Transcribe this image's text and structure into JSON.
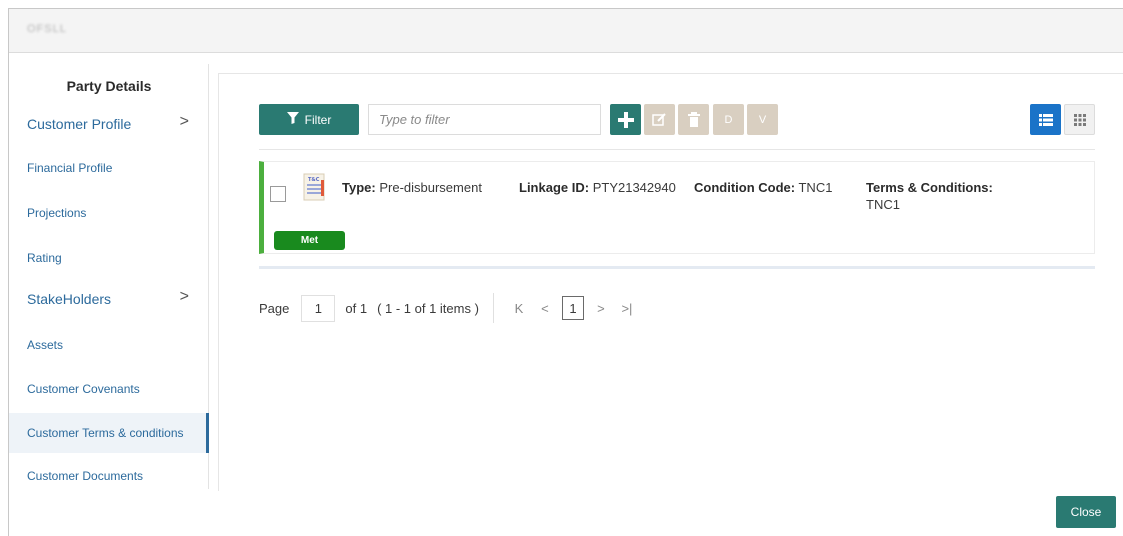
{
  "window": {
    "title": "OFSLL"
  },
  "sidebar": {
    "heading": "Party Details",
    "items": [
      {
        "label": "Customer Profile",
        "has_submenu": true
      },
      {
        "label": "Financial Profile",
        "has_submenu": false
      },
      {
        "label": "Projections",
        "has_submenu": false
      },
      {
        "label": "Rating",
        "has_submenu": false
      },
      {
        "label": "StakeHolders",
        "has_submenu": true
      },
      {
        "label": "Assets",
        "has_submenu": false
      },
      {
        "label": "Customer Covenants",
        "has_submenu": false
      },
      {
        "label": "Customer Terms & conditions",
        "has_submenu": false,
        "active": true
      },
      {
        "label": "Customer Documents",
        "has_submenu": false
      }
    ],
    "chevron": ">"
  },
  "toolbar": {
    "filter_label": "Filter",
    "filter_placeholder": "Type to filter",
    "add_icon": "plus-icon",
    "edit_icon": "edit-icon",
    "delete_icon": "trash-icon",
    "d_label": "D",
    "v_label": "V",
    "list_view_icon": "list-view-icon",
    "grid_view_icon": "grid-view-icon"
  },
  "records": [
    {
      "type_label": "Type:",
      "type_value": "Pre-disbursement",
      "linkage_label": "Linkage ID:",
      "linkage_value": "PTY21342940",
      "code_label": "Condition Code:",
      "code_value": "TNC1",
      "terms_label": "Terms & Conditions:",
      "terms_value": "TNC1",
      "status": "Met",
      "icon_text": "T&C"
    }
  ],
  "pagination": {
    "page_label": "Page",
    "page_value": "1",
    "of_label": "of 1",
    "range_label": "( 1 - 1 of 1 items )",
    "first": "K",
    "prev": "<",
    "current": "1",
    "next": ">",
    "last": ">|"
  },
  "footer": {
    "close_label": "Close"
  },
  "colors": {
    "primary": "#2a7a72",
    "accent_blue": "#1a73c8",
    "link": "#2c6a9c",
    "met_green": "#198a1e",
    "card_border": "#4caf3e",
    "disabled_btn": "#d9cfc1"
  }
}
